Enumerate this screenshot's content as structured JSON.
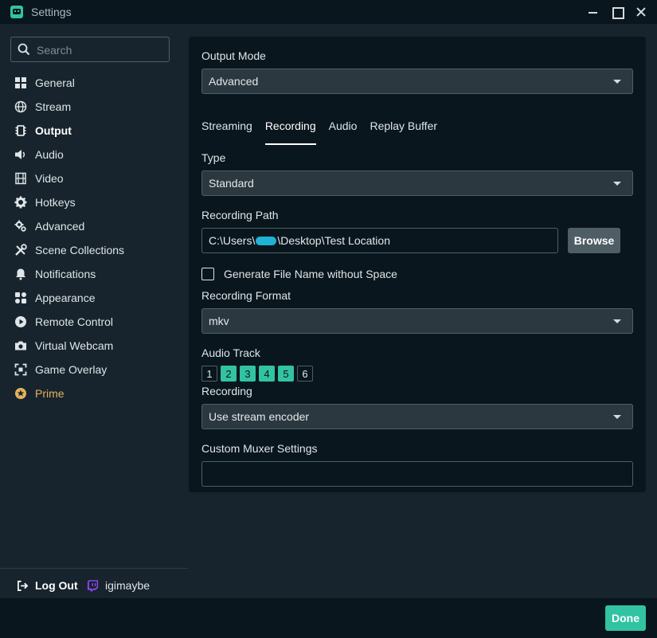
{
  "window": {
    "title": "Settings"
  },
  "sidebar": {
    "search_placeholder": "Search",
    "items": [
      {
        "label": "General",
        "icon": "grid-icon"
      },
      {
        "label": "Stream",
        "icon": "globe-icon"
      },
      {
        "label": "Output",
        "icon": "chip-icon"
      },
      {
        "label": "Audio",
        "icon": "speaker-icon"
      },
      {
        "label": "Video",
        "icon": "film-icon"
      },
      {
        "label": "Hotkeys",
        "icon": "gear-icon"
      },
      {
        "label": "Advanced",
        "icon": "gears-icon"
      },
      {
        "label": "Scene Collections",
        "icon": "tools-icon"
      },
      {
        "label": "Notifications",
        "icon": "bell-icon"
      },
      {
        "label": "Appearance",
        "icon": "palette-icon"
      },
      {
        "label": "Remote Control",
        "icon": "play-circle-icon"
      },
      {
        "label": "Virtual Webcam",
        "icon": "camera-icon"
      },
      {
        "label": "Game Overlay",
        "icon": "expand-icon"
      },
      {
        "label": "Prime",
        "icon": "prime-icon"
      }
    ],
    "active_item": "Output",
    "logout_label": "Log Out",
    "username": "igimaybe"
  },
  "output": {
    "output_mode_label": "Output Mode",
    "output_mode_value": "Advanced",
    "tabs": [
      {
        "label": "Streaming"
      },
      {
        "label": "Recording"
      },
      {
        "label": "Audio"
      },
      {
        "label": "Replay Buffer"
      }
    ],
    "active_tab": "Recording",
    "type_label": "Type",
    "type_value": "Standard",
    "recording_path_label": "Recording Path",
    "recording_path_prefix": "C:\\Users\\",
    "recording_path_suffix": "\\Desktop\\Test Location",
    "browse_label": "Browse",
    "generate_filename_label": "Generate File Name without Space",
    "generate_filename_checked": false,
    "recording_format_label": "Recording Format",
    "recording_format_value": "mkv",
    "audio_track_label": "Audio Track",
    "audio_tracks": [
      {
        "label": "1",
        "enabled": false
      },
      {
        "label": "2",
        "enabled": true
      },
      {
        "label": "3",
        "enabled": true
      },
      {
        "label": "4",
        "enabled": true
      },
      {
        "label": "5",
        "enabled": true
      },
      {
        "label": "6",
        "enabled": false
      }
    ],
    "recording_encoder_label": "Recording",
    "recording_encoder_value": "Use stream encoder",
    "custom_muxer_label": "Custom Muxer Settings",
    "custom_muxer_value": ""
  },
  "footer": {
    "done_label": "Done"
  },
  "colors": {
    "accent": "#31c3a2",
    "prime": "#e6b25d",
    "twitch": "#9146ff",
    "panel_bg": "#09161d",
    "sidebar_bg": "#17242d"
  }
}
